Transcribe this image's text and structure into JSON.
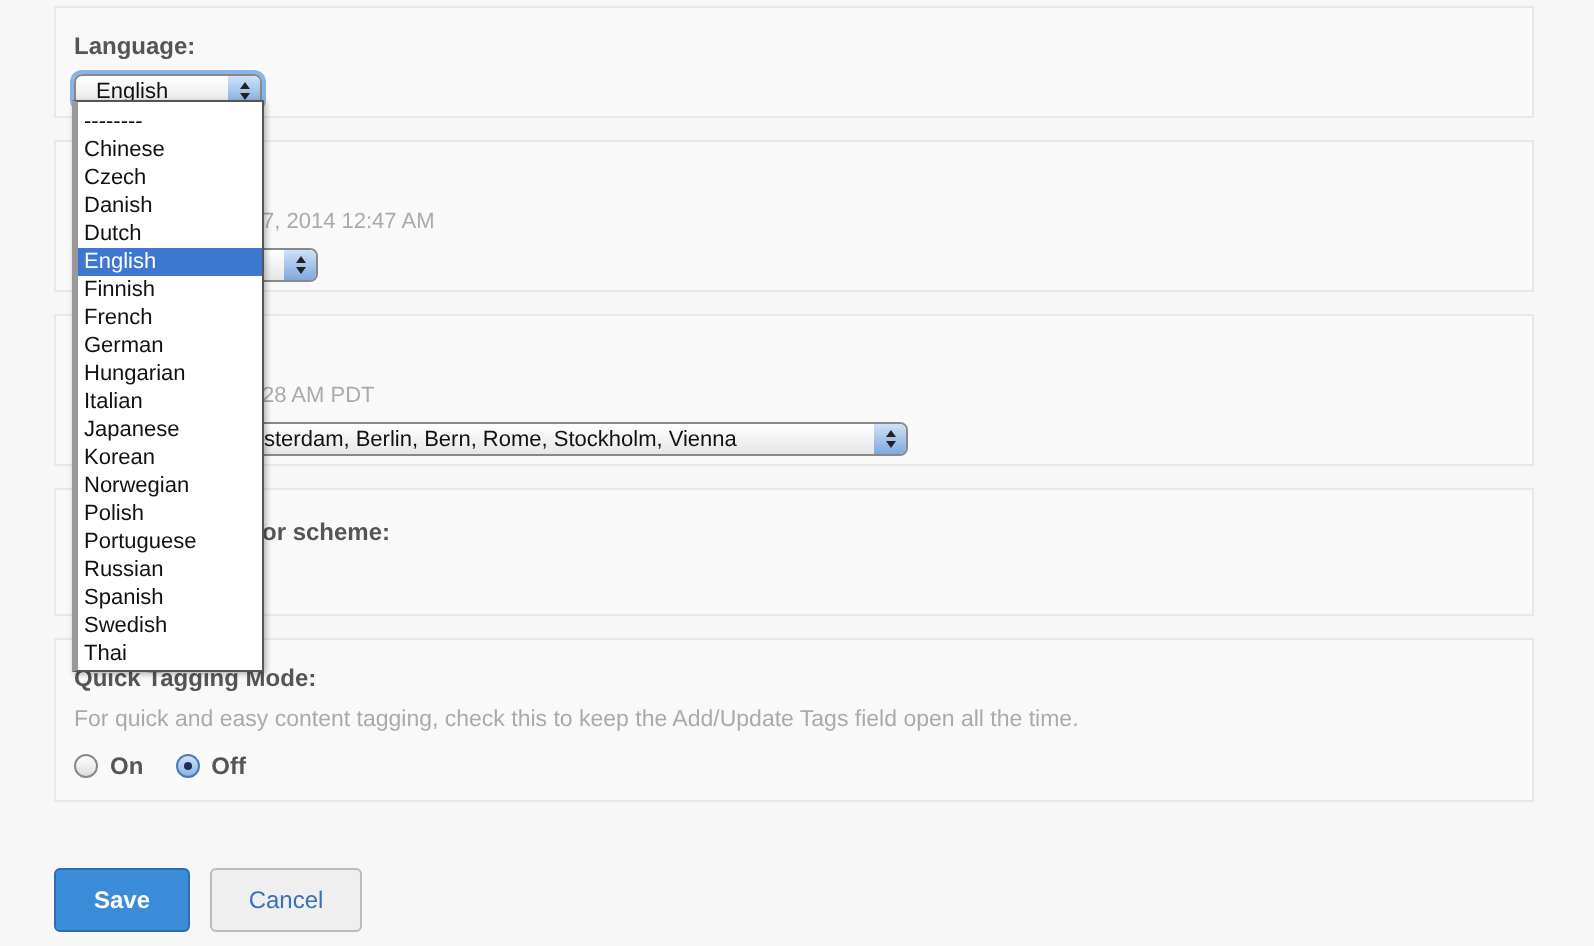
{
  "language": {
    "label": "Language:",
    "value": "English",
    "options": [
      {
        "label": "--------",
        "selected": false
      },
      {
        "label": "Chinese",
        "selected": false
      },
      {
        "label": "Czech",
        "selected": false
      },
      {
        "label": "Danish",
        "selected": false
      },
      {
        "label": "Dutch",
        "selected": false
      },
      {
        "label": "English",
        "selected": true
      },
      {
        "label": "Finnish",
        "selected": false
      },
      {
        "label": "French",
        "selected": false
      },
      {
        "label": "German",
        "selected": false
      },
      {
        "label": "Hungarian",
        "selected": false
      },
      {
        "label": "Italian",
        "selected": false
      },
      {
        "label": "Japanese",
        "selected": false
      },
      {
        "label": "Korean",
        "selected": false
      },
      {
        "label": "Norwegian",
        "selected": false
      },
      {
        "label": "Polish",
        "selected": false
      },
      {
        "label": "Portuguese",
        "selected": false
      },
      {
        "label": "Russian",
        "selected": false
      },
      {
        "label": "Spanish",
        "selected": false
      },
      {
        "label": "Swedish",
        "selected": false
      },
      {
        "label": "Thai",
        "selected": false
      }
    ]
  },
  "date_format": {
    "example": "7, 2014 12:47 AM"
  },
  "timezone": {
    "example": "28 AM PDT",
    "value": "sterdam, Berlin, Bern, Rome, Stockholm, Vienna"
  },
  "color_scheme": {
    "label": "or scheme:"
  },
  "quick_tagging": {
    "label": "Quick Tagging Mode:",
    "description": "For quick and easy content tagging, check this to keep the Add/Update Tags field open all the time.",
    "options": [
      {
        "label": "On",
        "selected": false
      },
      {
        "label": "Off",
        "selected": true
      }
    ]
  },
  "buttons": [
    {
      "label": "Save",
      "kind": "primary"
    },
    {
      "label": "Cancel",
      "kind": "secondary"
    }
  ]
}
